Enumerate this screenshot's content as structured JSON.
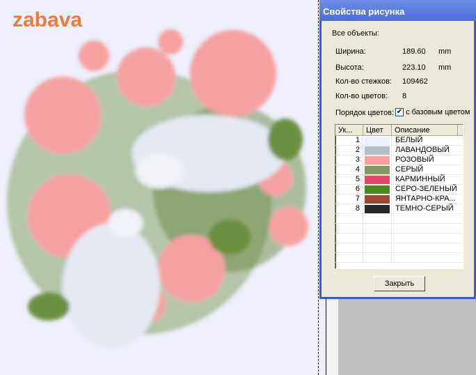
{
  "logo": "zabava",
  "dialog": {
    "title": "Свойства рисунка",
    "all_objects": "Все объекты:",
    "width_label": "Ширина:",
    "width_value": "189.60",
    "width_unit": "mm",
    "height_label": "Высота:",
    "height_value": "223.10",
    "height_unit": "mm",
    "stitches_label": "Кол-во стежков:",
    "stitches_value": "109462",
    "colors_label": "Кол-во цветов:",
    "colors_value": "8",
    "order_label": "Порядок цветов:",
    "order_checked": true,
    "order_check_label": "с базовым цветом",
    "columns": [
      "Ук...",
      "Цвет",
      "Описание"
    ],
    "rows": [
      {
        "n": "1",
        "color": "#eceffd",
        "desc": "БЕЛЫЙ"
      },
      {
        "n": "2",
        "color": "#b4c0c8",
        "desc": "ЛАВАНДОВЫЙ"
      },
      {
        "n": "3",
        "color": "#f8a0a0",
        "desc": "РОЗОВЫЙ"
      },
      {
        "n": "4",
        "color": "#849860",
        "desc": "СЕРЫЙ"
      },
      {
        "n": "5",
        "color": "#e84868",
        "desc": "КАРМИННЫЙ"
      },
      {
        "n": "6",
        "color": "#4c8820",
        "desc": "СЕРО-ЗЕЛЕНЫЙ"
      },
      {
        "n": "7",
        "color": "#a04838",
        "desc": "ЯНТАРНО-КРА..."
      },
      {
        "n": "8",
        "color": "#282824",
        "desc": "ТЕМНО-СЕРЫЙ"
      }
    ],
    "close_label": "Закрыть"
  }
}
